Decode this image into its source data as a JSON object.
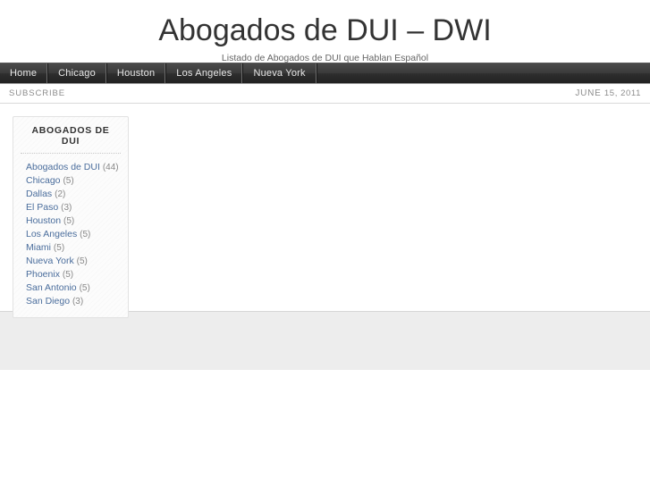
{
  "header": {
    "title": "Abogados de DUI – DWI",
    "tagline": "Listado de Abogados de DUI que Hablan Español"
  },
  "nav": {
    "items": [
      {
        "label": "Home"
      },
      {
        "label": "Chicago"
      },
      {
        "label": "Houston"
      },
      {
        "label": "Los Angeles"
      },
      {
        "label": "Nueva York"
      }
    ]
  },
  "subscribe_bar": {
    "subscribe_label": "SUBSCRIBE",
    "date_month": "JUNE",
    "date_rest": "15, 2011"
  },
  "sidebar": {
    "widget": {
      "title": "ABOGADOS DE DUI",
      "categories": [
        {
          "label": "Abogados de DUI",
          "count": "(44)"
        },
        {
          "label": "Chicago",
          "count": "(5)"
        },
        {
          "label": "Dallas",
          "count": "(2)"
        },
        {
          "label": "El Paso",
          "count": "(3)"
        },
        {
          "label": "Houston",
          "count": "(5)"
        },
        {
          "label": "Los Angeles",
          "count": "(5)"
        },
        {
          "label": "Miami",
          "count": "(5)"
        },
        {
          "label": "Nueva York",
          "count": "(5)"
        },
        {
          "label": "Phoenix",
          "count": "(5)"
        },
        {
          "label": "San Antonio",
          "count": "(5)"
        },
        {
          "label": "San Diego",
          "count": "(3)"
        }
      ]
    }
  },
  "colors": {
    "link": "#4a6d9c",
    "nav_background": "#333333",
    "footer_background": "#ededed",
    "muted_text": "#8c8c8c"
  }
}
